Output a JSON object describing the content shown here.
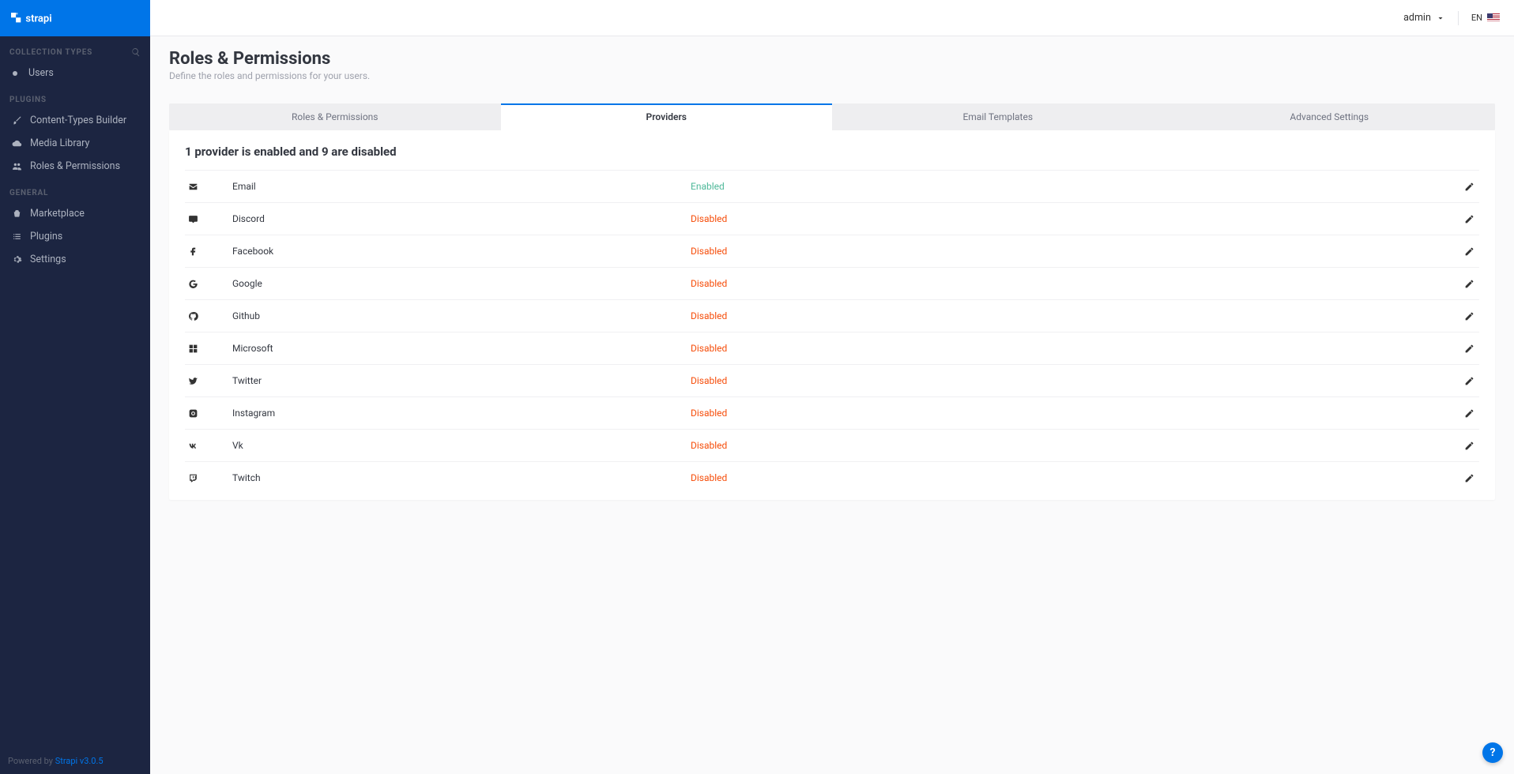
{
  "brand": "strapi",
  "sidebar": {
    "sections": [
      {
        "title": "COLLECTION TYPES",
        "searchable": true,
        "items": [
          {
            "label": "Users",
            "icon": "bullet"
          }
        ]
      },
      {
        "title": "PLUGINS",
        "searchable": false,
        "items": [
          {
            "label": "Content-Types Builder",
            "icon": "brush"
          },
          {
            "label": "Media Library",
            "icon": "cloud"
          },
          {
            "label": "Roles & Permissions",
            "icon": "users"
          }
        ]
      },
      {
        "title": "GENERAL",
        "searchable": false,
        "items": [
          {
            "label": "Marketplace",
            "icon": "basket"
          },
          {
            "label": "Plugins",
            "icon": "list"
          },
          {
            "label": "Settings",
            "icon": "gear"
          }
        ]
      }
    ],
    "footer_prefix": "Powered by ",
    "footer_link": "Strapi v3.0.5"
  },
  "topbar": {
    "user": "admin",
    "locale": "EN"
  },
  "page": {
    "title": "Roles & Permissions",
    "subtitle": "Define the roles and permissions for your users."
  },
  "tabs": [
    {
      "label": "Roles & Permissions",
      "active": false
    },
    {
      "label": "Providers",
      "active": true
    },
    {
      "label": "Email Templates",
      "active": false
    },
    {
      "label": "Advanced Settings",
      "active": false
    }
  ],
  "panel": {
    "heading": "1 provider is enabled and 9 are disabled",
    "status_labels": {
      "enabled": "Enabled",
      "disabled": "Disabled"
    },
    "providers": [
      {
        "name": "Email",
        "icon": "envelope",
        "enabled": true
      },
      {
        "name": "Discord",
        "icon": "discord",
        "enabled": false
      },
      {
        "name": "Facebook",
        "icon": "facebook",
        "enabled": false
      },
      {
        "name": "Google",
        "icon": "google",
        "enabled": false
      },
      {
        "name": "Github",
        "icon": "github",
        "enabled": false
      },
      {
        "name": "Microsoft",
        "icon": "microsoft",
        "enabled": false
      },
      {
        "name": "Twitter",
        "icon": "twitter",
        "enabled": false
      },
      {
        "name": "Instagram",
        "icon": "instagram",
        "enabled": false
      },
      {
        "name": "Vk",
        "icon": "vk",
        "enabled": false
      },
      {
        "name": "Twitch",
        "icon": "twitch",
        "enabled": false
      }
    ]
  }
}
